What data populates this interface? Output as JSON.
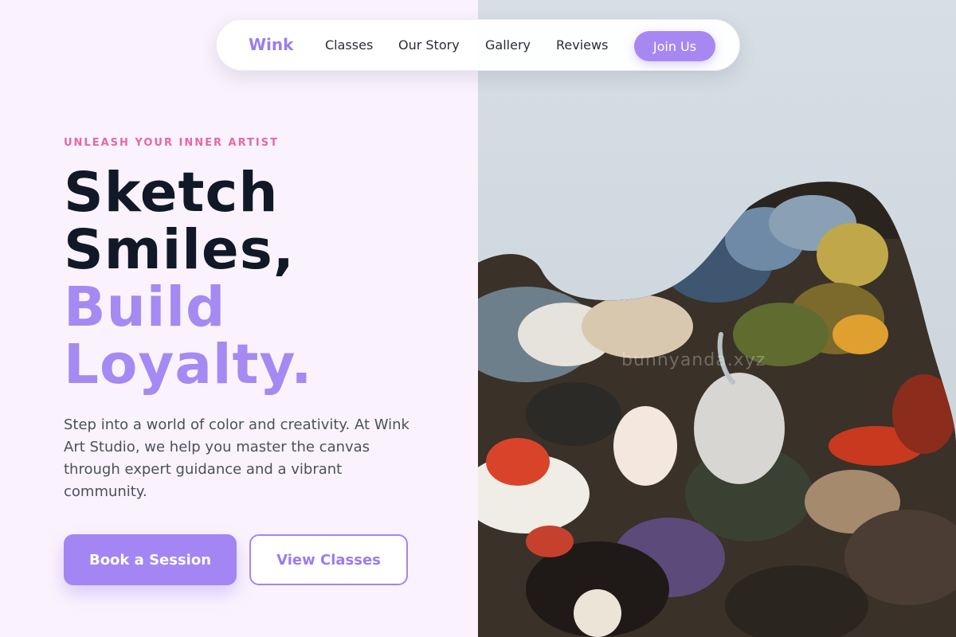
{
  "nav": {
    "logo": "Wink",
    "links": [
      "Classes",
      "Our Story",
      "Gallery",
      "Reviews"
    ],
    "cta": "Join Us"
  },
  "hero": {
    "eyebrow": "UNLEASH YOUR INNER ARTIST",
    "headline_dark": [
      "Sketch",
      "Smiles,"
    ],
    "headline_accent": [
      "Build",
      "Loyalty."
    ],
    "lede": "Step into a world of color and creativity. At Wink Art Studio, we help you master the canvas through expert guidance and a vibrant community.",
    "primary_button": "Book a Session",
    "secondary_button": "View Classes"
  },
  "image": {
    "watermark": "bunnyanda.xyz"
  },
  "colors": {
    "accent": "#a385f3",
    "eyebrow": "#e667a8",
    "heading": "#111827",
    "background": "#faf3fd"
  }
}
